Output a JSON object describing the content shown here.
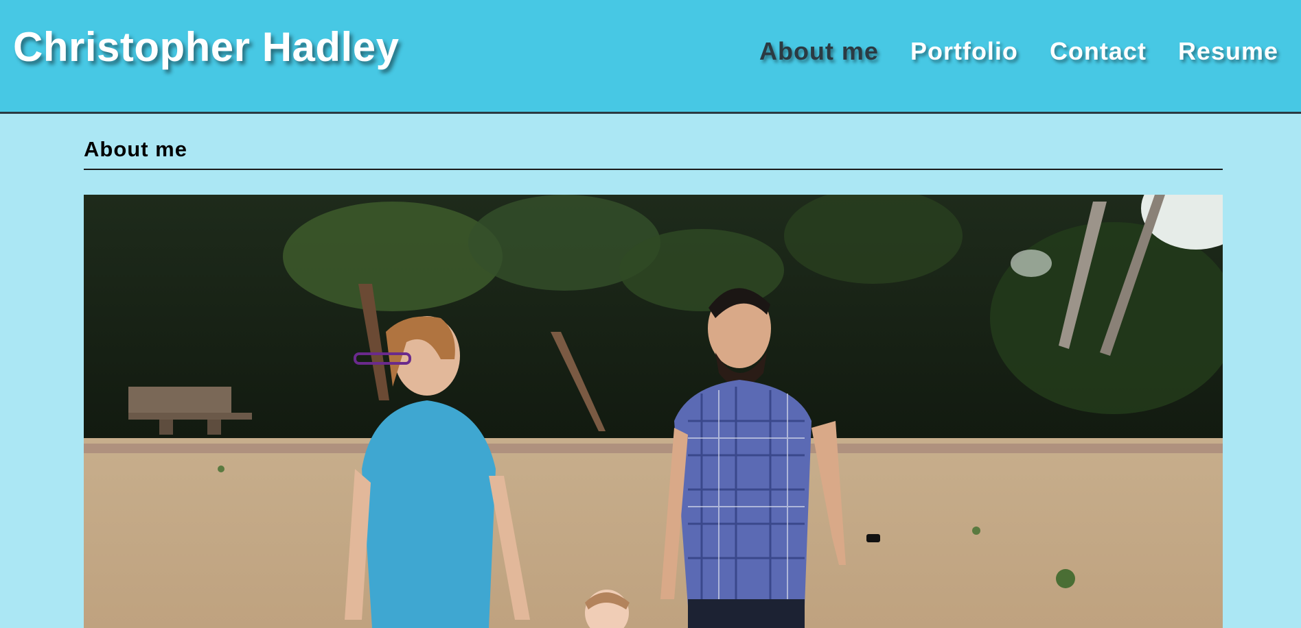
{
  "header": {
    "site_title": "Christopher Hadley",
    "nav": [
      {
        "label": "About me",
        "active": true
      },
      {
        "label": "Portfolio",
        "active": false
      },
      {
        "label": "Contact",
        "active": false
      },
      {
        "label": "Resume",
        "active": false
      }
    ]
  },
  "main": {
    "section_title": "About me",
    "photo": {
      "description_icon": "family-photo-image"
    }
  },
  "colors": {
    "header_bg": "#47c8e4",
    "page_bg": "#abe7f4",
    "active_nav": "#2b3a42",
    "nav_text": "#ffffff"
  }
}
